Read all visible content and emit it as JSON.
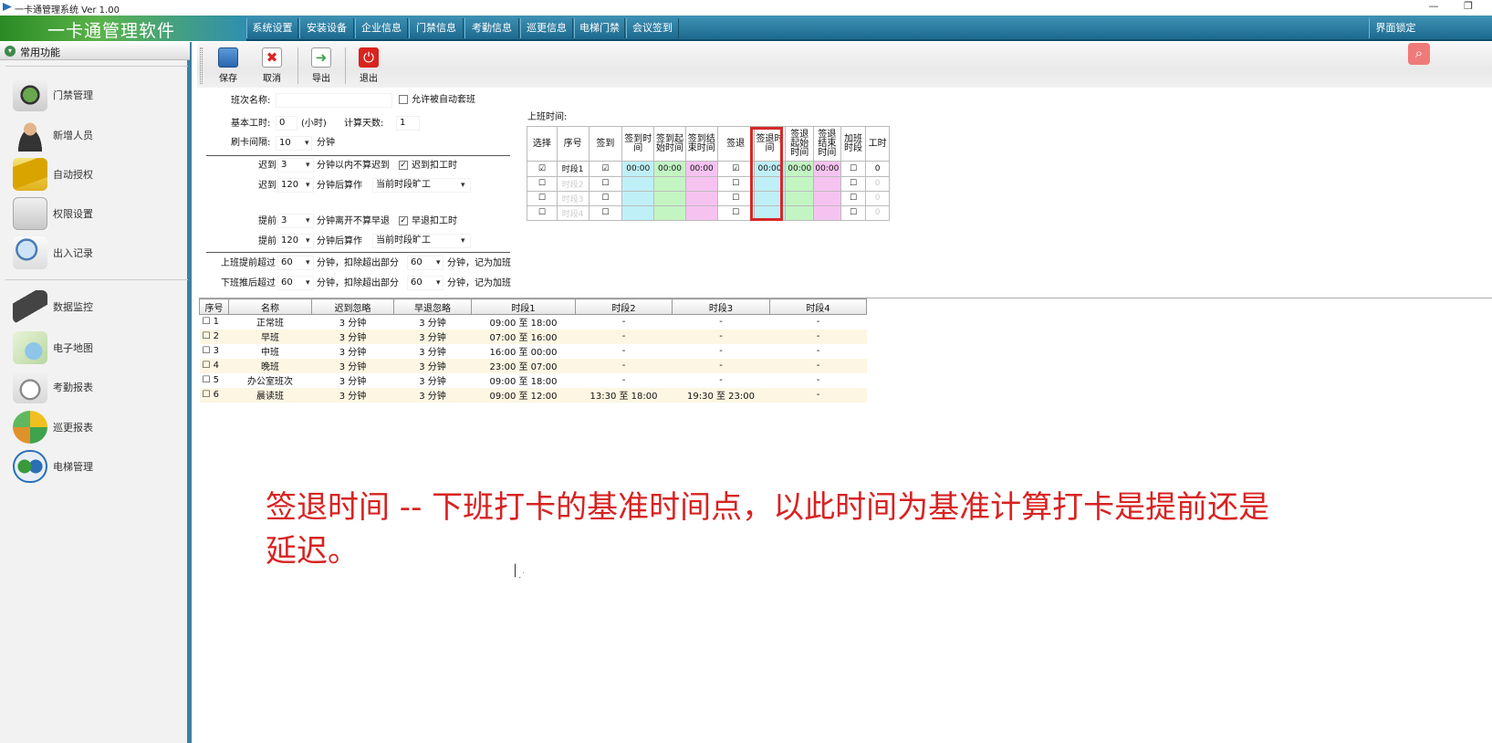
{
  "window": {
    "title": "一卡通管理系统  Ver 1.00",
    "minimize": "—",
    "restore": "❐"
  },
  "app": {
    "logo_text": "一卡通管理软件"
  },
  "menu": [
    "系统设置",
    "安装设备",
    "企业信息",
    "门禁信息",
    "考勤信息",
    "巡更信息",
    "电梯门禁",
    "会议签到"
  ],
  "lock_button": "界面锁定",
  "sidebar": {
    "header": "常用功能",
    "items": [
      {
        "label": "门禁管理",
        "icon": "access-control-icon"
      },
      {
        "label": "新增人员",
        "icon": "person-icon"
      },
      {
        "label": "自动授权",
        "icon": "card-icon"
      },
      {
        "label": "权限设置",
        "icon": "permission-icon"
      },
      {
        "label": "出入记录",
        "icon": "magnifier-icon"
      },
      {
        "label": "数据监控",
        "icon": "camera-icon"
      },
      {
        "label": "电子地图",
        "icon": "map-icon"
      },
      {
        "label": "考勤报表",
        "icon": "stopwatch-icon"
      },
      {
        "label": "巡更报表",
        "icon": "patrol-icon"
      },
      {
        "label": "电梯管理",
        "icon": "elevator-icon"
      }
    ]
  },
  "toolbar": {
    "save": "保存",
    "cancel": "取消",
    "export": "导出",
    "exit": "退出"
  },
  "form": {
    "shift_name_label": "班次名称:",
    "shift_name_value": "",
    "auto_shift_label": "允许被自动套班",
    "base_hours_label": "基本工时:",
    "base_hours_value": "0",
    "hours_unit": "(小时)",
    "count_days_label": "计算天数:",
    "count_days_value": "1",
    "swipe_interval_label": "刷卡间隔:",
    "swipe_interval_value": "10",
    "minutes": "分钟",
    "late_label": "迟到",
    "late_value": "3",
    "late_ignore_text": "分钟以内不算迟到",
    "late_deduct_label": "迟到扣工时",
    "late2_label": "迟到",
    "late2_value": "120",
    "after_text": "分钟后算作",
    "late2_option": "当前时段旷工",
    "early_label": "提前",
    "early_value": "3",
    "early_ignore_text": "分钟离开不算早退",
    "early_deduct_label": "早退扣工时",
    "early2_label": "提前",
    "early2_value": "120",
    "early2_option": "当前时段旷工",
    "ot_before_label": "上班提前超过",
    "ot_before_value": "60",
    "ot_after_label": "下班推后超过",
    "ot_after_value": "60",
    "deduct_text": "分钟，扣除超出部分",
    "deduct_value1": "60",
    "deduct_value2": "60",
    "record_ot_text": "分钟，记为加班"
  },
  "shift_time": {
    "label": "上班时间:",
    "headers": [
      "选择",
      "序号",
      "签到",
      "签到时间",
      "签到起始时间",
      "签到结束时间",
      "签退",
      "签退时间",
      "签退起始时间",
      "签退结束时间",
      "加班时段",
      "工时"
    ],
    "rows": [
      {
        "selected": true,
        "name": "时段1",
        "checkin": true,
        "t1": "00:00",
        "t2": "00:00",
        "t3": "00:00",
        "checkout": true,
        "t4": "00:00",
        "t5": "00:00",
        "t6": "00:00",
        "ot": false,
        "hours": "0"
      },
      {
        "selected": false,
        "name": "时段2",
        "checkin": false,
        "t1": "",
        "t2": "",
        "t3": "",
        "checkout": false,
        "t4": "",
        "t5": "",
        "t6": "",
        "ot": false,
        "hours": "0"
      },
      {
        "selected": false,
        "name": "时段3",
        "checkin": false,
        "t1": "",
        "t2": "",
        "t3": "",
        "checkout": false,
        "t4": "",
        "t5": "",
        "t6": "",
        "ot": false,
        "hours": "0"
      },
      {
        "selected": false,
        "name": "时段4",
        "checkin": false,
        "t1": "",
        "t2": "",
        "t3": "",
        "checkout": false,
        "t4": "",
        "t5": "",
        "t6": "",
        "ot": false,
        "hours": "0"
      }
    ]
  },
  "shift_list": {
    "headers": [
      "序号",
      "名称",
      "迟到忽略",
      "早退忽略",
      "时段1",
      "时段2",
      "时段3",
      "时段4"
    ],
    "rows": [
      [
        "1",
        "正常班",
        "3 分钟",
        "3 分钟",
        "09:00 至 18:00",
        "-",
        "-",
        "-"
      ],
      [
        "2",
        "早班",
        "3 分钟",
        "3 分钟",
        "07:00 至 16:00",
        "-",
        "-",
        "-"
      ],
      [
        "3",
        "中班",
        "3 分钟",
        "3 分钟",
        "16:00 至 00:00",
        "-",
        "-",
        "-"
      ],
      [
        "4",
        "晚班",
        "3 分钟",
        "3 分钟",
        "23:00 至 07:00",
        "-",
        "-",
        "-"
      ],
      [
        "5",
        "办公室班次",
        "3 分钟",
        "3 分钟",
        "09:00 至 18:00",
        "-",
        "-",
        "-"
      ],
      [
        "6",
        "晨读班",
        "3 分钟",
        "3 分钟",
        "09:00 至 12:00",
        "13:30 至 18:00",
        "19:30 至 23:00",
        "-"
      ]
    ]
  },
  "caption": "签退时间 -- 下班打卡的基准时间点，以此时间为基准计算打卡是提前还是延迟。",
  "colors": {
    "menubar": "#1c6a8e",
    "highlight": "#d62828",
    "caption": "#d82222"
  }
}
